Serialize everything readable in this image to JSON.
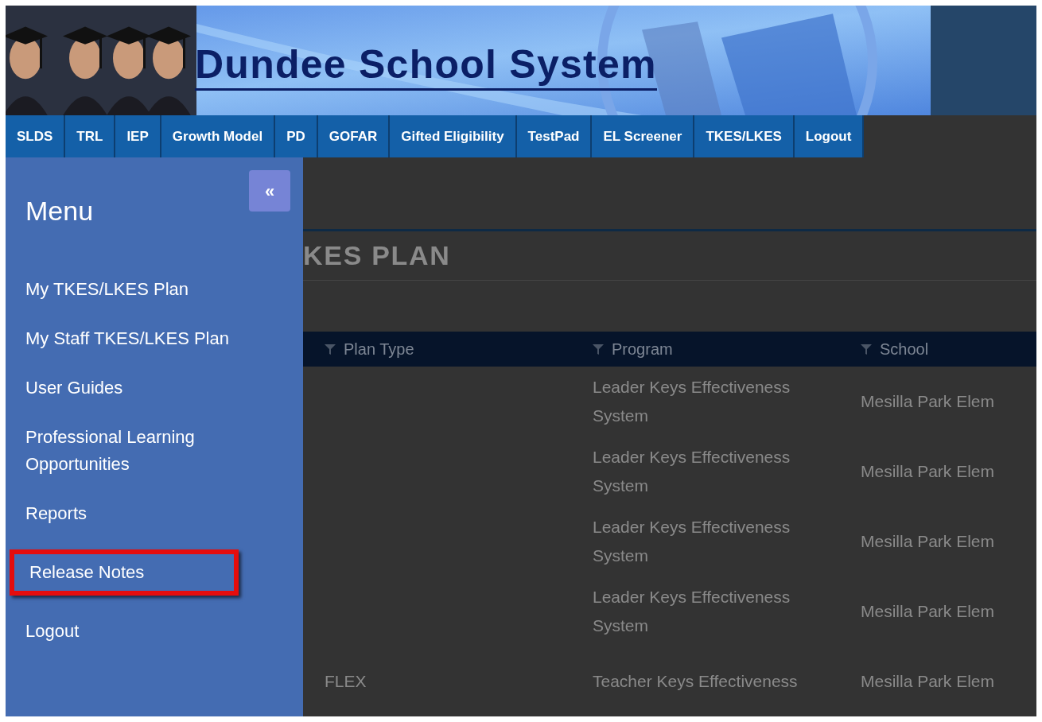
{
  "banner": {
    "title": "Dundee School System"
  },
  "nav": [
    {
      "label": "SLDS"
    },
    {
      "label": "TRL"
    },
    {
      "label": "IEP"
    },
    {
      "label": "Growth Model"
    },
    {
      "label": "PD"
    },
    {
      "label": "GOFAR"
    },
    {
      "label": "Gifted Eligibility"
    },
    {
      "label": "TestPad"
    },
    {
      "label": "EL Screener"
    },
    {
      "label": "TKES/LKES"
    },
    {
      "label": "Logout"
    }
  ],
  "menu": {
    "title": "Menu",
    "collapse": "«",
    "items": [
      {
        "label": "My TKES/LKES Plan",
        "annotated": false
      },
      {
        "label": "My Staff TKES/LKES Plan",
        "annotated": false
      },
      {
        "label": "User Guides",
        "annotated": false
      },
      {
        "label": "Professional Learning Opportunities",
        "annotated": false
      },
      {
        "label": "Reports",
        "annotated": false
      },
      {
        "label": "Release Notes",
        "annotated": true
      },
      {
        "label": "Logout",
        "annotated": false
      }
    ]
  },
  "page": {
    "title": "KES PLAN"
  },
  "table": {
    "columns": [
      "Plan Type",
      "Program",
      "School"
    ],
    "rows": [
      [
        "",
        "Leader Keys Effectiveness System",
        "Mesilla Park Elem"
      ],
      [
        "",
        "Leader Keys Effectiveness System",
        "Mesilla Park Elem"
      ],
      [
        "",
        "Leader Keys Effectiveness System",
        "Mesilla Park Elem"
      ],
      [
        "",
        "Leader Keys Effectiveness System",
        "Mesilla Park Elem"
      ],
      [
        "FLEX",
        "Teacher Keys Effectiveness",
        "Mesilla Park Elem"
      ]
    ]
  }
}
